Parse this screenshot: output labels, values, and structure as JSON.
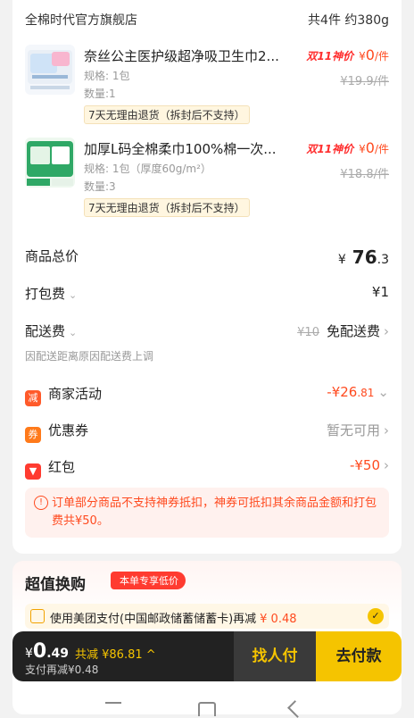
{
  "store": {
    "name": "全棉时代官方旗舰店",
    "summary": "共4件 约380g"
  },
  "products": [
    {
      "title": "奈丝公主医护级超净吸卫生巾2...",
      "spec": "规格: 1包",
      "qty": "数量:1",
      "return_tag": "7天无理由退货（拆封后不支持）",
      "badge": "双11神价",
      "price_currency": "¥",
      "price": "0",
      "unit": "/件",
      "orig_price": "¥19.9/件"
    },
    {
      "title": "加厚L码全棉柔巾100%棉一次...",
      "spec": "规格: 1包（厚度60g/m²）",
      "qty": "数量:3",
      "return_tag": "7天无理由退货（拆封后不支持）",
      "badge": "双11神价",
      "price_currency": "¥",
      "price": "0",
      "unit": "/件",
      "orig_price": "¥18.8/件"
    }
  ],
  "summary_rows": {
    "total_label": "商品总价",
    "total_currency": "¥",
    "total_int": "76",
    "total_dec": ".3",
    "packing_label": "打包费",
    "packing_value": "¥1",
    "delivery_label": "配送费",
    "delivery_orig": "¥10",
    "delivery_value": "免配送费",
    "delivery_note": "因配送距离原因配送费上调",
    "merchant_label": "商家活动",
    "merchant_icon": "减",
    "merchant_value_int": "-¥26",
    "merchant_value_dec": ".81",
    "coupon_label": "优惠券",
    "coupon_icon": "券",
    "coupon_value": "暂无可用",
    "redpack_label": "红包",
    "redpack_value": "-¥50"
  },
  "warning": "订单部分商品不支持神券抵扣，神券可抵扣其余商品金额和打包费共¥50。",
  "exchange": {
    "title": "超值换购",
    "badge": "本单专享低价",
    "pay_text": "使用美团支付(中国邮政储蓄储蓄卡)再减",
    "pay_amount": "¥ 0.48"
  },
  "paybar": {
    "currency": "¥",
    "price_int": "0",
    "price_dec": ".49",
    "savings": "共减 ¥86.81",
    "sub": "支付再减¥0.48",
    "find_pay": "找人付",
    "pay_now": "去付款"
  },
  "colors": {
    "accent": "#ff4a1f",
    "yellow": "#f5c400",
    "dark": "#222222"
  }
}
